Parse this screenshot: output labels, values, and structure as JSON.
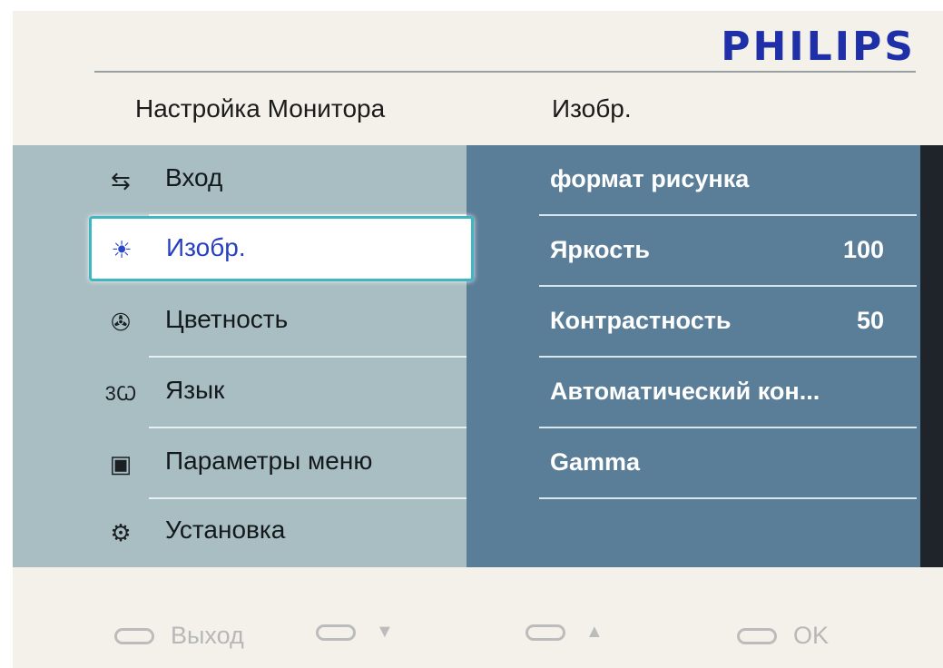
{
  "brand": "PHILIPS",
  "header": {
    "left": "Настройка Монитора",
    "right": "Изобр."
  },
  "left_menu": [
    {
      "label": "Вход",
      "icon": "input-icon",
      "glyph": "⇆"
    },
    {
      "label": "Изобр.",
      "icon": "brightness-icon",
      "glyph": "☀",
      "selected": true
    },
    {
      "label": "Цветность",
      "icon": "color-icon",
      "glyph": "✇"
    },
    {
      "label": "Язык",
      "icon": "language-icon",
      "glyph": "3Ꞷ"
    },
    {
      "label": "Параметры меню",
      "icon": "menu-settings-icon",
      "glyph": "▣"
    },
    {
      "label": "Установка",
      "icon": "setup-gear-icon",
      "glyph": "⚙"
    }
  ],
  "right_menu": [
    {
      "label": "формат рисунка",
      "value": ""
    },
    {
      "label": "Яркость",
      "value": "100"
    },
    {
      "label": "Контрастность",
      "value": "50"
    },
    {
      "label": "Автоматический кон...",
      "value": ""
    },
    {
      "label": "Gamma",
      "value": ""
    },
    {
      "label": "",
      "value": ""
    }
  ],
  "footer": {
    "exit": "Выход",
    "down": "▼",
    "up": "▲",
    "ok": "OK"
  }
}
